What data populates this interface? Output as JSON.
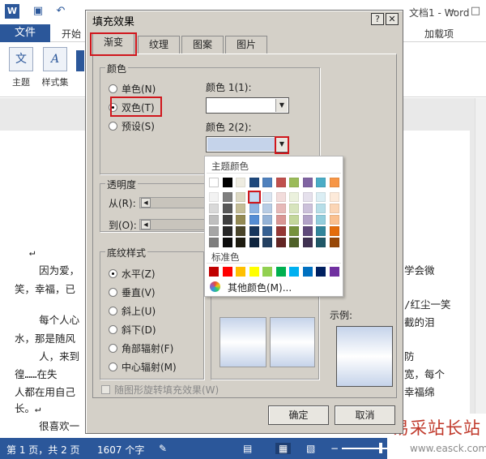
{
  "word": {
    "title": "文档1 - Word",
    "quick_access": [
      "save-icon",
      "undo-icon"
    ],
    "tabs": {
      "file": "文件",
      "home": "开始",
      "addins": "加载项"
    },
    "ribbon": {
      "theme_label": "主题",
      "styles_label": "样式集"
    },
    "document_lines": [
      "↵",
      "    因为爱，",
      "笑，幸福，已",
      "    每个人心",
      "水，那是随风",
      "    人，来到",
      "徨……在失",
      "人都在用自己",
      "长。↵",
      "    很喜欢一"
    ],
    "document_right_lines": [
      "学会微",
      "/红尘一笑",
      "截的泪",
      "防",
      "宽，每个",
      "幸福绵"
    ],
    "status": {
      "page": "第 1 页，共 2 页",
      "words": "1607 个字"
    },
    "watermark": {
      "title": "易采站长站",
      "url": "www.easck.com"
    }
  },
  "dialog": {
    "title": "填充效果",
    "help": "?",
    "close": "✕",
    "tabs": [
      "渐变",
      "纹理",
      "图案",
      "图片"
    ],
    "active_tab": 0,
    "colors": {
      "group_label": "颜色",
      "options": [
        "单色(N)",
        "双色(T)",
        "预设(S)"
      ],
      "selected": 1,
      "color1_label": "颜色 1(1):",
      "color2_label": "颜色 2(2):",
      "color1_value": "#ffffff",
      "color2_value": "#c5d3ea"
    },
    "transparency": {
      "group_label": "透明度",
      "from_label": "从(R):",
      "to_label": "到(O):"
    },
    "shading": {
      "group_label": "底纹样式",
      "options": [
        "水平(Z)",
        "垂直(V)",
        "斜上(U)",
        "斜下(D)",
        "角部辐射(F)",
        "中心辐射(M)"
      ],
      "selected": 0
    },
    "sample_label": "示例:",
    "rotate_label": "随图形旋转填充效果(W)",
    "ok": "确定",
    "cancel": "取消"
  },
  "color_popup": {
    "theme_title": "主题颜色",
    "standard_title": "标准色",
    "more_colors": "其他颜色(M)...",
    "theme_columns": [
      [
        "#ffffff",
        "#f2f2f2",
        "#d9d9d9",
        "#bfbfbf",
        "#a6a6a6",
        "#7f7f7f"
      ],
      [
        "#000000",
        "#7f7f7f",
        "#595959",
        "#3f3f3f",
        "#262626",
        "#0d0d0d"
      ],
      [
        "#eeece1",
        "#ddd9c4",
        "#c4bd97",
        "#948a54",
        "#4a452a",
        "#1e1c11"
      ],
      [
        "#1f497d",
        "#c6d9f1",
        "#8db3e2",
        "#548dd4",
        "#17365d",
        "#0f243e"
      ],
      [
        "#4f81bd",
        "#dbe5f1",
        "#b8cce4",
        "#95b3d7",
        "#366092",
        "#244061"
      ],
      [
        "#c0504d",
        "#f2dcdb",
        "#e6b9b8",
        "#d99694",
        "#953735",
        "#632523"
      ],
      [
        "#9bbb59",
        "#ebf1dd",
        "#d7e4bd",
        "#c3d69b",
        "#76923c",
        "#4f6128"
      ],
      [
        "#8064a2",
        "#e5e0ec",
        "#ccc1da",
        "#b2a2c7",
        "#5f497a",
        "#3f3151"
      ],
      [
        "#4bacc6",
        "#dbeef4",
        "#b7dee8",
        "#92cddc",
        "#31859b",
        "#205867"
      ],
      [
        "#f79646",
        "#fdeada",
        "#fbd5b5",
        "#fac08f",
        "#e46c0a",
        "#984807"
      ]
    ],
    "standard_colors": [
      "#c00000",
      "#ff0000",
      "#ffc000",
      "#ffff00",
      "#92d050",
      "#00b050",
      "#00b0f0",
      "#0070c0",
      "#002060",
      "#7030a0"
    ],
    "selected_cell": {
      "column": 3,
      "row": 1
    },
    "highlight_color": "#d0161c"
  }
}
